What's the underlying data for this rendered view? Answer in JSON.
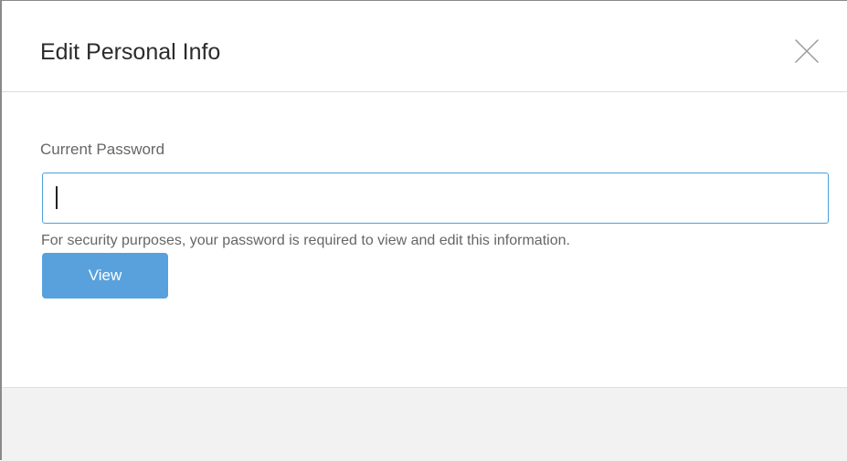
{
  "modal": {
    "title": "Edit Personal Info",
    "close_icon": "close-icon"
  },
  "form": {
    "current_password_label": "Current Password",
    "current_password_value": "",
    "help_text": "For security purposes, your password is required to view and edit this information.",
    "view_button_label": "View"
  },
  "colors": {
    "accent": "#58a1dc",
    "input_border": "#4aa0dd",
    "footer_bg": "#f2f2f2"
  }
}
